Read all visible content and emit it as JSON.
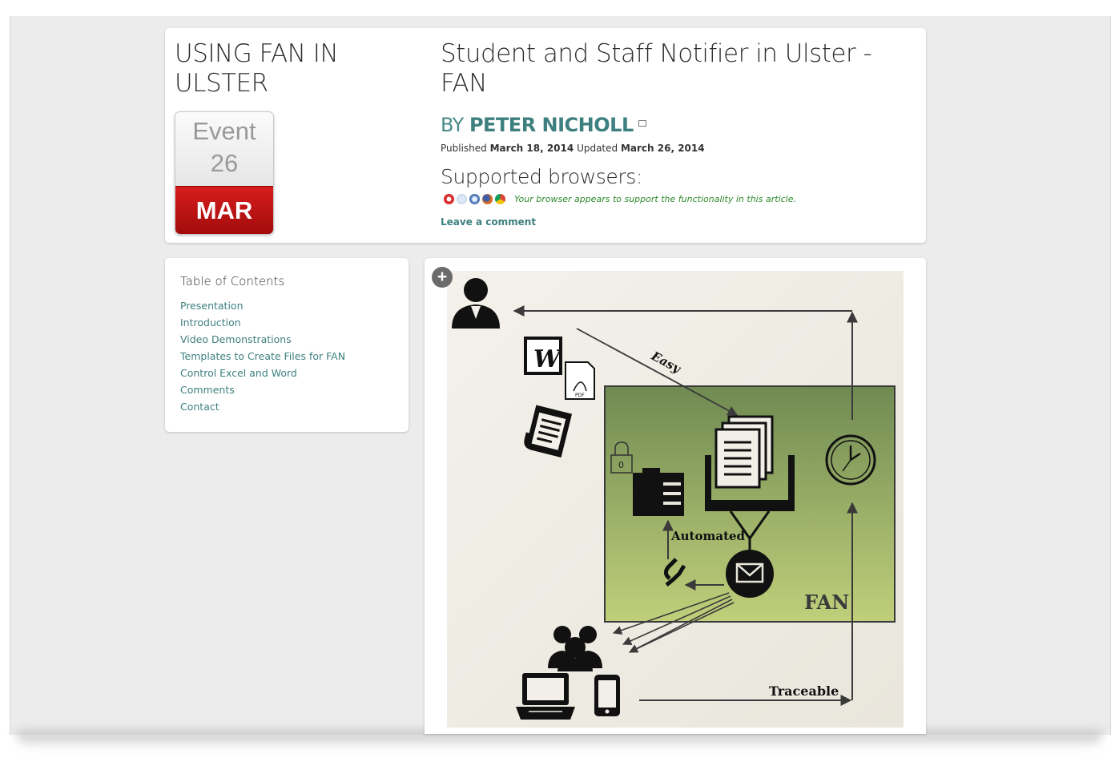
{
  "event": {
    "title": "USING FAN IN ULSTER",
    "calendar_label": "Event",
    "calendar_day": "26",
    "calendar_month": "MAR"
  },
  "post": {
    "title": "Student and Staff Notifier in Ulster - FAN",
    "by_prefix": "BY",
    "author": "PETER NICHOLL",
    "published_label": "Published",
    "published_date": "March 18, 2014",
    "updated_label": "Updated",
    "updated_date": "March 26, 2014",
    "supported_heading": "Supported browsers:",
    "browsers": [
      "opera-icon",
      "ie-icon",
      "safari-icon",
      "firefox-icon",
      "chrome-icon"
    ],
    "support_message": "Your browser appears to support the functionality in this article.",
    "leave_comment": "Leave a comment"
  },
  "toc": {
    "heading": "Table of Contents",
    "items": [
      {
        "label": "Presentation"
      },
      {
        "label": "Introduction"
      },
      {
        "label": "Video Demonstrations"
      },
      {
        "label": "Templates to Create Files for FAN"
      },
      {
        "label": "Control Excel and Word"
      },
      {
        "label": "Comments"
      },
      {
        "label": "Contact"
      }
    ]
  },
  "diagram": {
    "zoom_symbol": "+",
    "label_easy": "Easy",
    "label_automated": "Automated",
    "label_fan": "FAN",
    "label_traceable": "Traceable",
    "word_letter": "W",
    "pdf_text": "PDF",
    "lock_number": "0",
    "colors": {
      "fan_box_top": "#6f8a52",
      "fan_box_bottom": "#c0cf7a",
      "paper": "#f1efe7"
    }
  }
}
